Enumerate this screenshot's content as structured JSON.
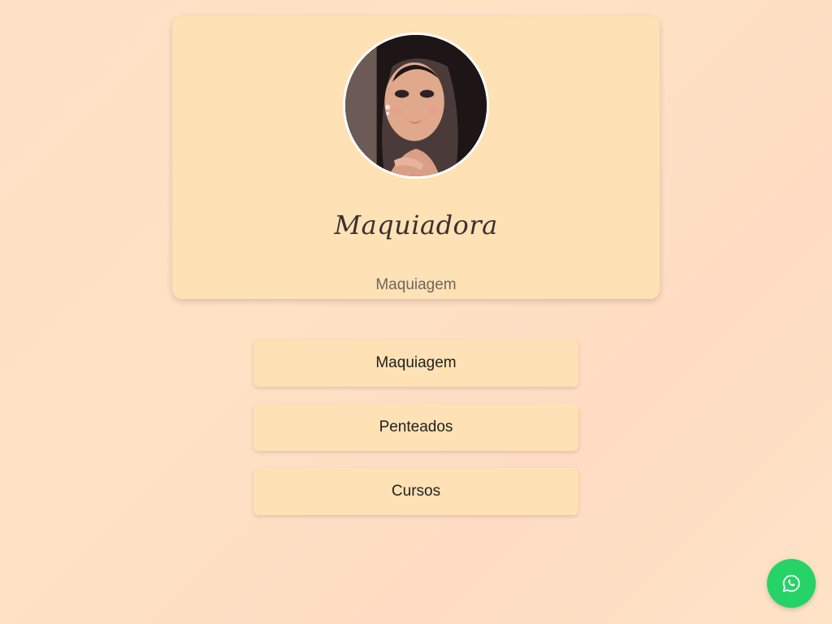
{
  "profile": {
    "name": "Maquiadora",
    "subtitle": "Maquiagem",
    "avatar_alt": "Foto de perfil"
  },
  "links": [
    {
      "label": "Maquiagem"
    },
    {
      "label": "Penteados"
    },
    {
      "label": "Cursos"
    }
  ],
  "floating": {
    "whatsapp_icon": "whatsapp-icon",
    "whatsapp_color": "#25d366"
  },
  "colors": {
    "card_bg": "#fee1b4",
    "page_bg": "#fde0c6"
  }
}
